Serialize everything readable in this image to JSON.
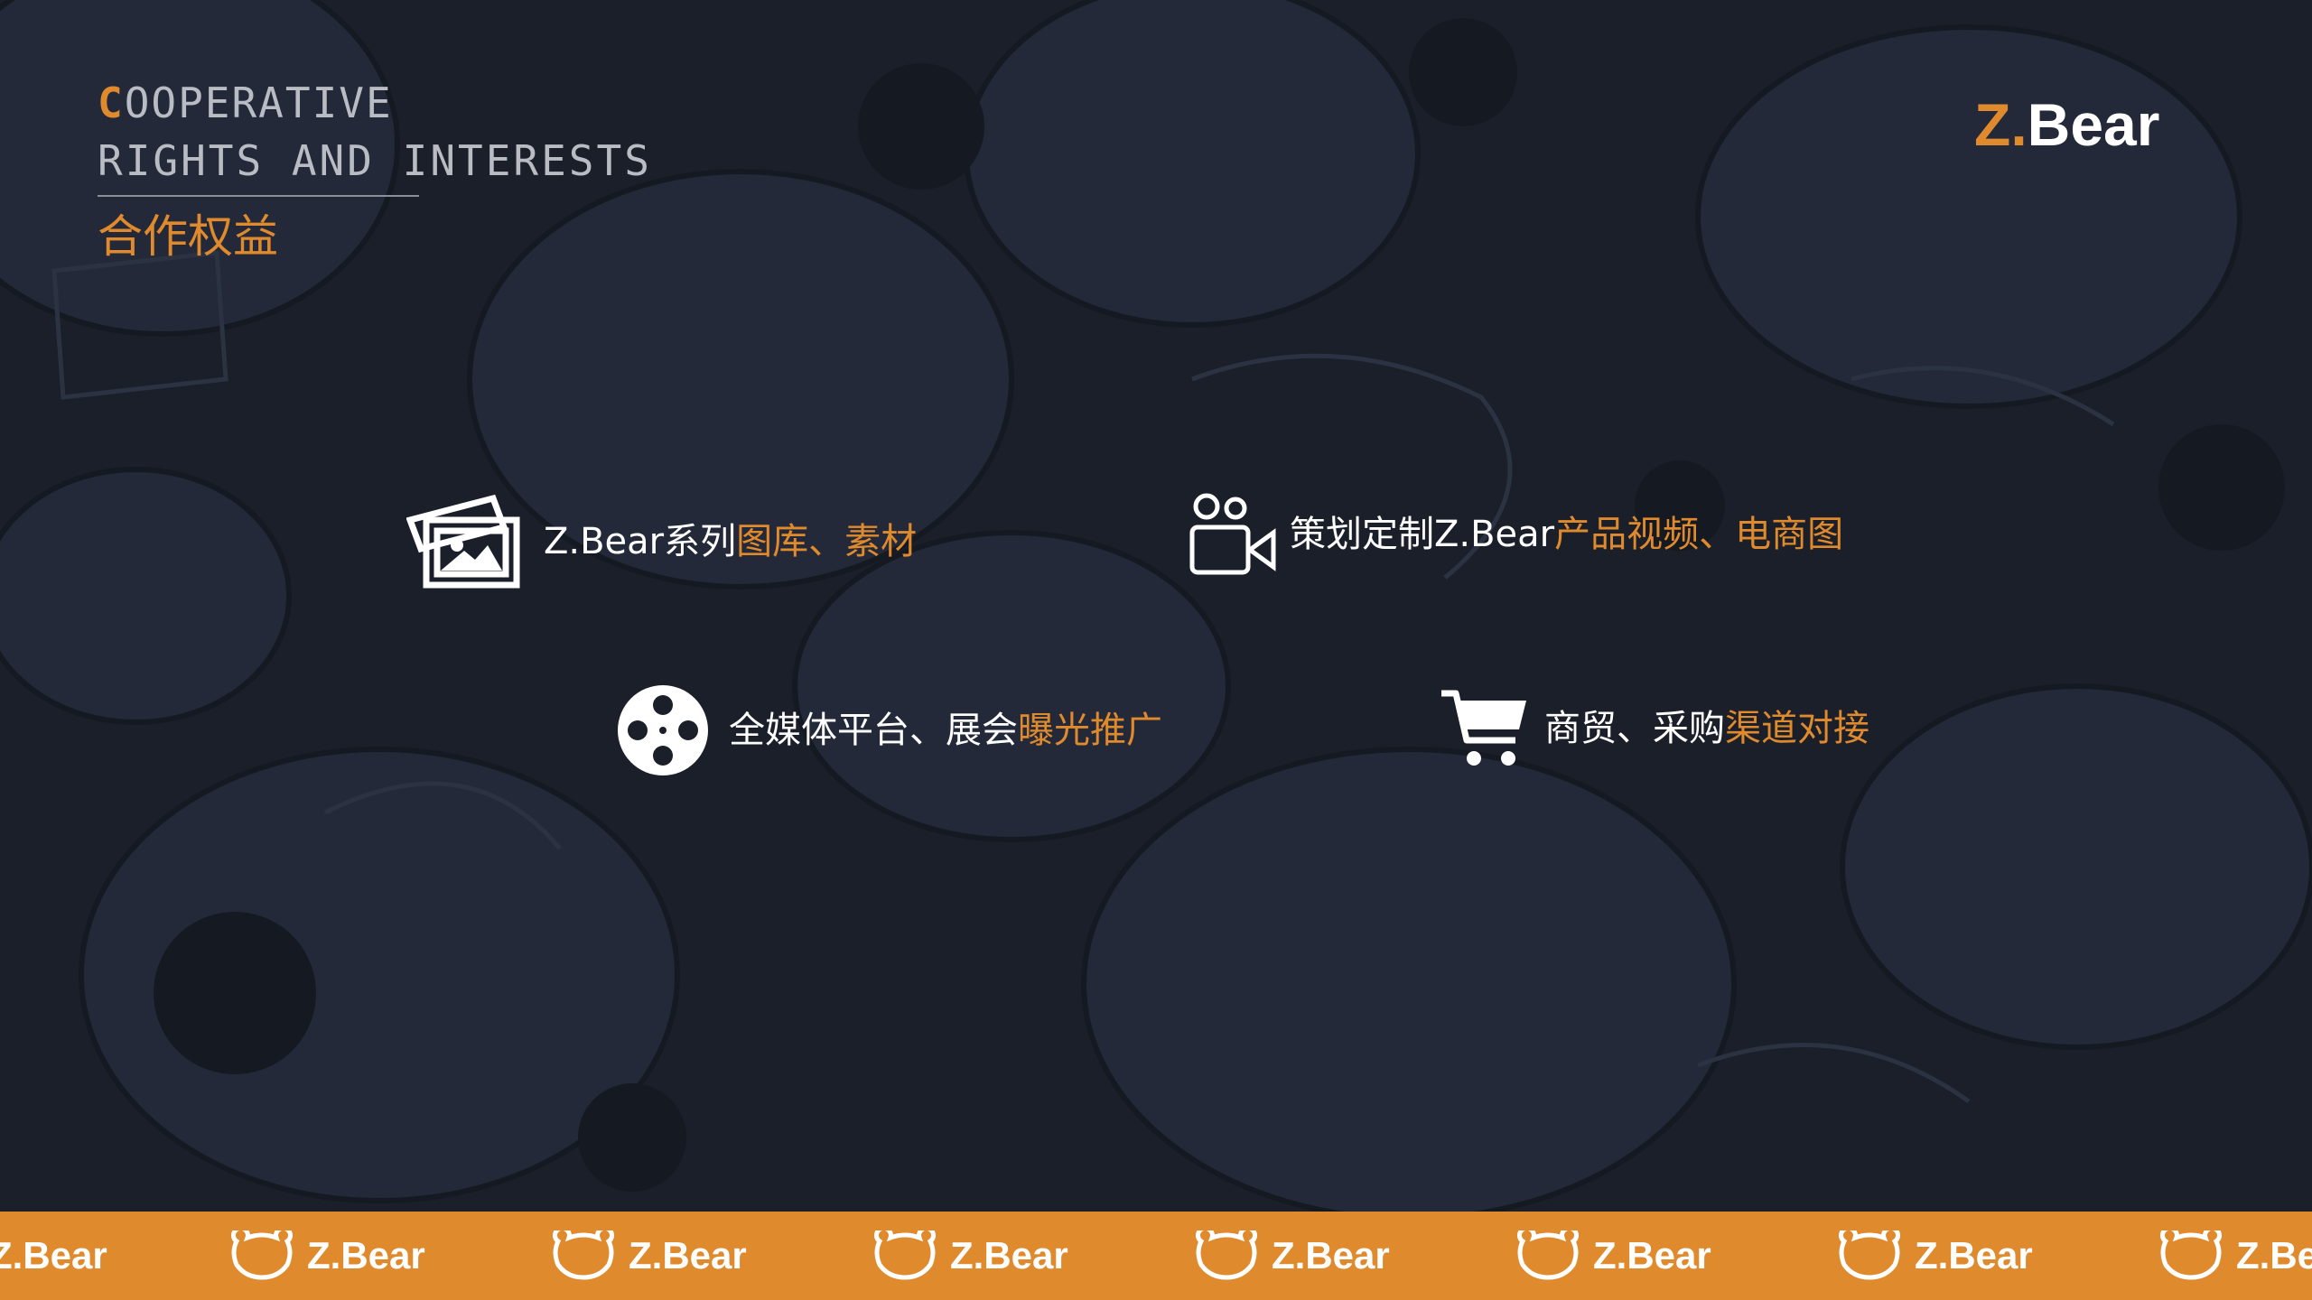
{
  "colors": {
    "accent": "#e08a2e",
    "background": "#1b1f2a",
    "text": "#ffffff",
    "muted": "#b9bcc3"
  },
  "heading": {
    "line1_first": "C",
    "line1_rest": "OOPERATIVE",
    "line2": "RIGHTS AND INTERESTS",
    "title_cn": "合作权益"
  },
  "logo": {
    "z": "Z.",
    "bear": "Bear"
  },
  "features": [
    {
      "icon": "image-gallery-icon",
      "white": "Z.Bear系列",
      "orange": "图库、素材"
    },
    {
      "icon": "video-camera-icon",
      "white": "策划定制Z.Bear",
      "orange": "产品视频、电商图"
    },
    {
      "icon": "film-reel-icon",
      "white": "全媒体平台、展会",
      "orange": "曝光推广"
    },
    {
      "icon": "shopping-cart-icon",
      "white": "商贸、采购",
      "orange": "渠道对接"
    }
  ],
  "footer": {
    "brand_label": "Z.Bear",
    "edge_label": "Z.Be"
  }
}
